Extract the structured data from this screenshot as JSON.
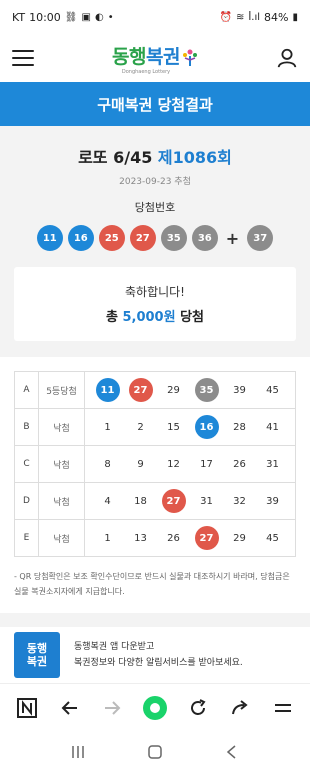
{
  "statusbar": {
    "carrier": "KT",
    "time": "10:00",
    "dot": "•",
    "signal": "ꟾ.ıl",
    "battery": "84%"
  },
  "header": {
    "logo": {
      "part1": "동행",
      "part2": "복권",
      "sub": "Donghaeng Lottery"
    }
  },
  "page_title": "구매복권 당첨결과",
  "lotto": {
    "title_prefix": "로또 6/45",
    "round": "제1086회",
    "date": "2023-09-23 추첨",
    "winning_label": "당첨번호",
    "winning_numbers": [
      "11",
      "16",
      "25",
      "27",
      "35",
      "36"
    ],
    "winning_colors": [
      "#1e88d8",
      "#1e88d8",
      "#e0584a",
      "#e0584a",
      "#8c8c8c",
      "#8c8c8c"
    ],
    "plus": "+",
    "bonus": "37",
    "bonus_color": "#8c8c8c"
  },
  "congrats": {
    "line1": "축하합니다!",
    "prefix": "총",
    "amount": "5,000원",
    "suffix": "당첨"
  },
  "tickets": [
    {
      "id": "A",
      "result": "5등당첨",
      "numbers": [
        "11",
        "27",
        "29",
        "35",
        "39",
        "45"
      ],
      "hits": [
        "#1e88d8",
        "#e0584a",
        "",
        "#8c8c8c",
        "",
        ""
      ]
    },
    {
      "id": "B",
      "result": "낙첨",
      "numbers": [
        "1",
        "2",
        "15",
        "16",
        "28",
        "41"
      ],
      "hits": [
        "",
        "",
        "",
        "#1e88d8",
        "",
        ""
      ]
    },
    {
      "id": "C",
      "result": "낙첨",
      "numbers": [
        "8",
        "9",
        "12",
        "17",
        "26",
        "31"
      ],
      "hits": [
        "",
        "",
        "",
        "",
        "",
        ""
      ]
    },
    {
      "id": "D",
      "result": "낙첨",
      "numbers": [
        "4",
        "18",
        "27",
        "31",
        "32",
        "39"
      ],
      "hits": [
        "",
        "",
        "#e0584a",
        "",
        "",
        ""
      ]
    },
    {
      "id": "E",
      "result": "낙첨",
      "numbers": [
        "1",
        "13",
        "26",
        "27",
        "29",
        "45"
      ],
      "hits": [
        "",
        "",
        "",
        "#e0584a",
        "",
        ""
      ]
    }
  ],
  "notice": "- QR 당첨확인은 보조 확인수단이므로 반드시 실물과 대조하시기 바라며, 당첨금은 실물 복권소지자에게 지급합니다.",
  "promo": {
    "logo_line1": "동행",
    "logo_line2": "복권",
    "line1": "동행복권 앱 다운받고",
    "line2": "복권정보와 다양한 알림서비스를 받아보세요."
  },
  "browserbar": {
    "icons": [
      "n-icon",
      "back-arrow-icon",
      "forward-arrow-icon",
      "home-circle-icon",
      "reload-icon",
      "share-icon",
      "menu-icon"
    ]
  },
  "navbar": {
    "icons": [
      "recent-apps-icon",
      "home-icon",
      "back-icon"
    ]
  }
}
